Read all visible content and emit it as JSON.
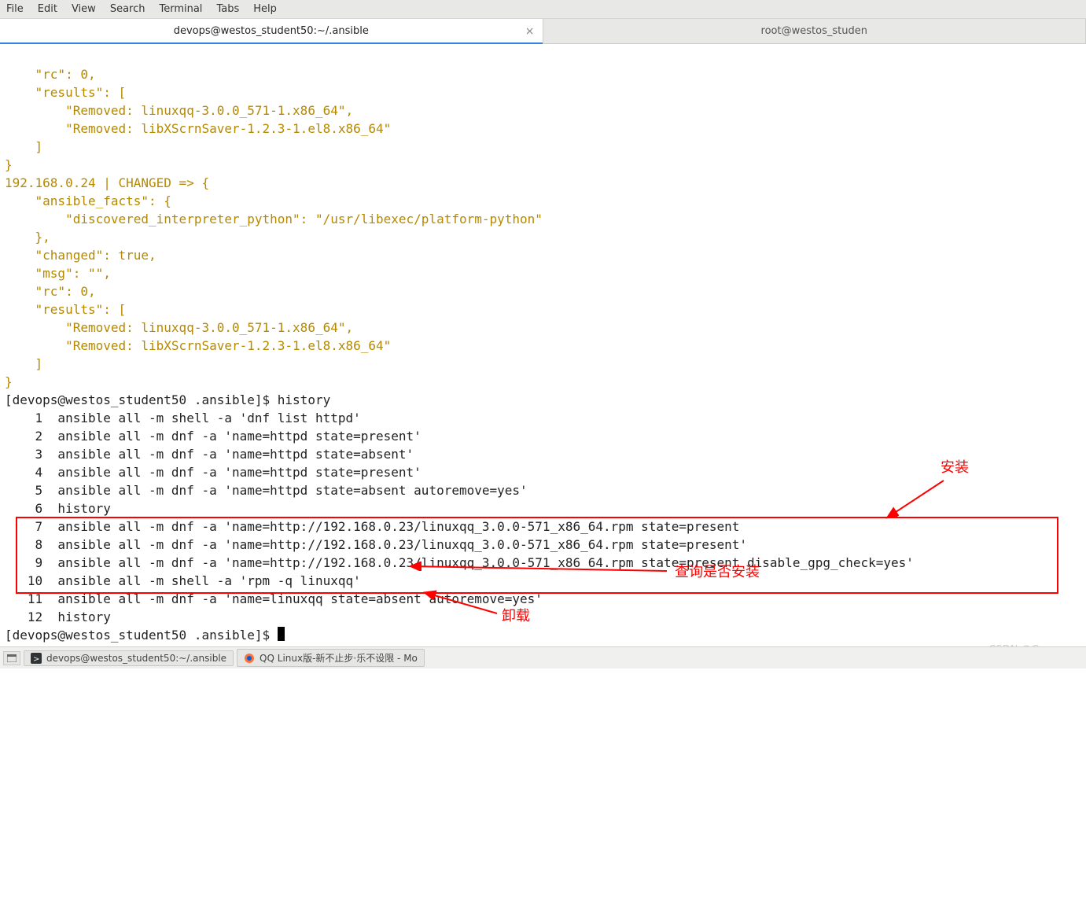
{
  "menubar": [
    "File",
    "Edit",
    "View",
    "Search",
    "Terminal",
    "Tabs",
    "Help"
  ],
  "tabs": {
    "active": {
      "title": "devops@westos_student50:~/.ansible",
      "close": "×"
    },
    "inactive": {
      "title": "root@westos_studen"
    }
  },
  "terminal": {
    "block1": "    \"rc\": 0,\n    \"results\": [\n        \"Removed: linuxqq-3.0.0_571-1.x86_64\",\n        \"Removed: libXScrnSaver-1.2.3-1.el8.x86_64\"\n    ]\n}\n192.168.0.24 | CHANGED => {\n    \"ansible_facts\": {\n        \"discovered_interpreter_python\": \"/usr/libexec/platform-python\"\n    },\n    \"changed\": true,\n    \"msg\": \"\",\n    \"rc\": 0,\n    \"results\": [\n        \"Removed: linuxqq-3.0.0_571-1.x86_64\",\n        \"Removed: libXScrnSaver-1.2.3-1.el8.x86_64\"\n    ]\n}",
    "prompt1": "[devops@westos_student50 .ansible]$ history",
    "history": "    1  ansible all -m shell -a 'dnf list httpd'\n    2  ansible all -m dnf -a 'name=httpd state=present'\n    3  ansible all -m dnf -a 'name=httpd state=absent'\n    4  ansible all -m dnf -a 'name=httpd state=present'\n    5  ansible all -m dnf -a 'name=httpd state=absent autoremove=yes'\n    6  history\n    7  ansible all -m dnf -a 'name=http://192.168.0.23/linuxqq_3.0.0-571_x86_64.rpm state=present\n    8  ansible all -m dnf -a 'name=http://192.168.0.23/linuxqq_3.0.0-571_x86_64.rpm state=present'\n    9  ansible all -m dnf -a 'name=http://192.168.0.23/linuxqq_3.0.0-571_x86_64.rpm state=present disable_gpg_check=yes'\n   10  ansible all -m shell -a 'rpm -q linuxqq'\n   11  ansible all -m dnf -a 'name=linuxqq state=absent autoremove=yes'\n   12  history",
    "prompt2": "[devops@westos_student50 .ansible]$ "
  },
  "annotations": {
    "install": "安装",
    "query": "查询是否安装",
    "uninstall": "卸载"
  },
  "taskbar": {
    "t1": "devops@westos_student50:~/.ansible",
    "t2": "QQ Linux版-新不止步·乐不设限 - Mo"
  },
  "watermark": "CSDN @Gong_yz"
}
